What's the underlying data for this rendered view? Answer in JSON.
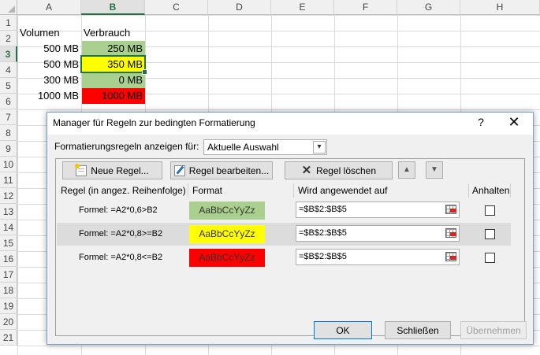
{
  "sheet": {
    "columns": [
      "A",
      "B",
      "C",
      "D",
      "E",
      "F",
      "G",
      "H"
    ],
    "selected_column": "B",
    "rows": [
      "1",
      "2",
      "3",
      "4",
      "5",
      "6",
      "7",
      "8",
      "9",
      "10",
      "11",
      "12",
      "13",
      "14",
      "15",
      "16",
      "17",
      "18",
      "19",
      "20",
      "21"
    ],
    "selected_row": "3",
    "cells": {
      "a1": "Volumen",
      "b1": "Verbrauch",
      "a2": "500 MB",
      "b2": "250 MB",
      "a3": "500 MB",
      "b3": "350 MB",
      "a4": "300 MB",
      "b4": "0 MB",
      "a5": "1000 MB",
      "b5": "1000 MB"
    },
    "cell_colors": {
      "b2": "#a9d08e",
      "b3": "#ffff00",
      "b4": "#a9d08e",
      "b5": "#ff0000"
    }
  },
  "dialog": {
    "title": "Manager für Regeln zur bedingten Formatierung",
    "help_glyph": "?",
    "close_glyph": "✕",
    "show_rules_label": "Formatierungsregeln anzeigen für:",
    "show_rules_value": "Aktuelle Auswahl",
    "buttons": {
      "new_rule": "Neue Regel...",
      "edit_rule": "Regel bearbeiten...",
      "delete_rule": "Regel löschen",
      "move_up": "▲",
      "move_down": "▼"
    },
    "table_headers": {
      "rule": "Regel (in angez. Reihenfolge)",
      "format": "Format",
      "applies_to": "Wird angewendet auf",
      "stop": "Anhalten"
    },
    "rules": [
      {
        "label": "Formel: =A2*0,6>B2",
        "format_preview": "AaBbCcYyZz",
        "format_color": "#a9d08e",
        "applies_to": "=$B$2:$B$5",
        "stop_if_true": false
      },
      {
        "label": "Formel: =A2*0,8>=B2",
        "format_preview": "AaBbCcYyZz",
        "format_color": "#ffff00",
        "applies_to": "=$B$2:$B$5",
        "stop_if_true": false
      },
      {
        "label": "Formel: =A2*0,8<=B2",
        "format_preview": "AaBbCcYyZz",
        "format_color": "#ff0000",
        "applies_to": "=$B$2:$B$5",
        "stop_if_true": false
      }
    ],
    "footer": {
      "ok": "OK",
      "close": "Schließen",
      "apply": "Übernehmen"
    }
  }
}
